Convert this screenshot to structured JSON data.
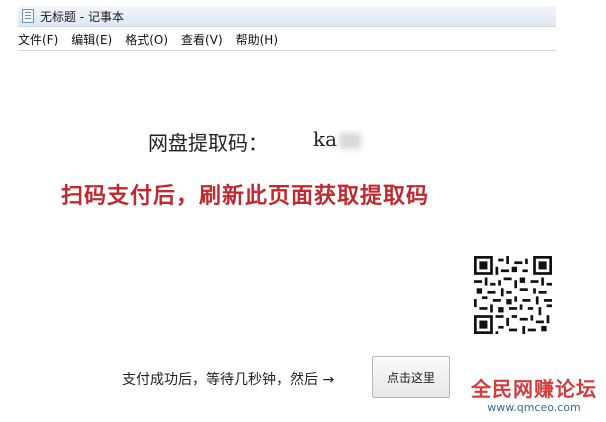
{
  "window": {
    "title": "无标题 - 记事本"
  },
  "menu": [
    "文件(F)",
    "编辑(E)",
    "格式(O)",
    "查看(V)",
    "帮助(H)"
  ],
  "extract": {
    "label": "网盘提取码：",
    "code_visible": "ka"
  },
  "instruction": "扫码支付后，刷新此页面获取提取码",
  "after_text": "支付成功后，等待几秒钟，然后 →",
  "button_label": "点击这里",
  "watermark": {
    "main": "全民网赚论坛",
    "url": "www.qmceo.com"
  }
}
